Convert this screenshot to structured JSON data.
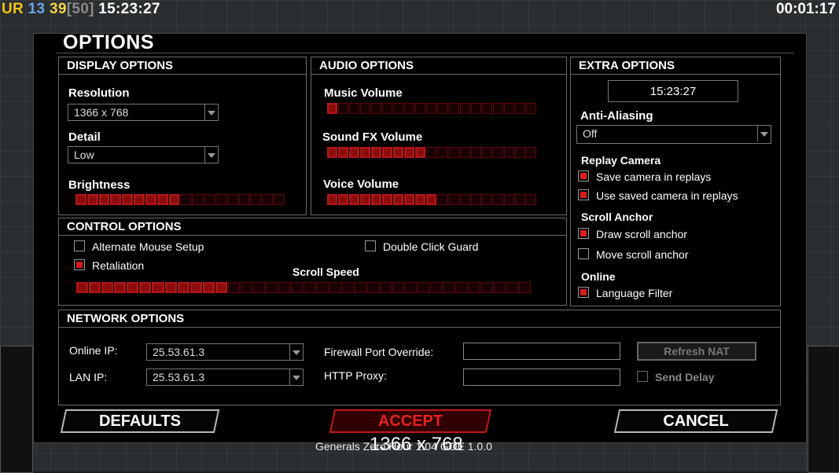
{
  "hud": {
    "ur": "UR",
    "num1": "13",
    "num2": "39",
    "bracket": "[50]",
    "time": "15:23:27",
    "timer": "00:01:17"
  },
  "title": "OPTIONS",
  "display": {
    "header": "DISPLAY OPTIONS",
    "resolution_label": "Resolution",
    "resolution_value": "1366 x 768",
    "detail_label": "Detail",
    "detail_value": "Low",
    "brightness_label": "Brightness",
    "brightness_level": 0.5
  },
  "audio": {
    "header": "AUDIO OPTIONS",
    "music_label": "Music Volume",
    "music_level": 0.05,
    "sfx_label": "Sound FX Volume",
    "sfx_level": 0.47,
    "voice_label": "Voice Volume",
    "voice_level": 0.53
  },
  "extra": {
    "header": "EXTRA OPTIONS",
    "clock": "15:23:27",
    "aa_label": "Anti-Aliasing",
    "aa_value": "Off",
    "replay_label": "Replay Camera",
    "save_cam": "Save camera in replays",
    "use_cam": "Use saved camera in replays",
    "scroll_anchor_label": "Scroll Anchor",
    "draw_anchor": "Draw scroll anchor",
    "move_anchor": "Move scroll anchor",
    "online_label": "Online",
    "lang_filter": "Language Filter"
  },
  "control": {
    "header": "CONTROL OPTIONS",
    "alt_mouse": "Alternate Mouse Setup",
    "retaliation": "Retaliation",
    "double_click": "Double Click Guard",
    "scroll_speed_label": "Scroll Speed",
    "scroll_speed_level": 0.32
  },
  "network": {
    "header": "NETWORK OPTIONS",
    "online_ip_label": "Online IP:",
    "online_ip_value": "25.53.61.3",
    "lan_ip_label": "LAN IP:",
    "lan_ip_value": "25.53.61.3",
    "firewall_label": "Firewall Port Override:",
    "proxy_label": "HTTP Proxy:",
    "refresh_label": "Refresh NAT",
    "send_delay_label": "Send Delay"
  },
  "buttons": {
    "defaults": "DEFAULTS",
    "accept": "ACCEPT",
    "cancel": "CANCEL"
  },
  "footer": "Generals Zero Hour 1.04 GOE 1.0.0",
  "overlay_res": "1366 x 768",
  "colors": {
    "accent": "#d81b1b",
    "panel_border": "#6b6b6b"
  }
}
